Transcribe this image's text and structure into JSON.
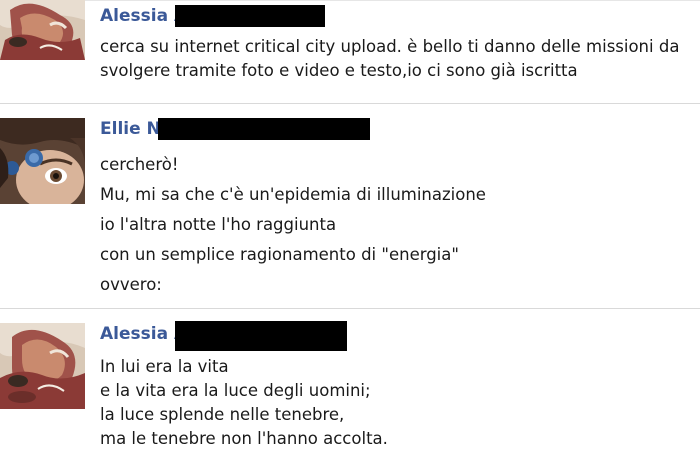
{
  "comments": [
    {
      "author": "Alessia A",
      "lines": [
        "cerca su internet critical city upload. è bello ti danno delle missioni da",
        "svolgere tramite foto e video e testo,io ci sono già iscritta"
      ]
    },
    {
      "author": "Ellie N",
      "lines": [
        "cercherò!",
        "Mu, mi sa che c'è un'epidemia di illuminazione",
        "io l'altra notte l'ho raggiunta",
        "con un semplice ragionamento di \"energia\"",
        "ovvero:"
      ]
    },
    {
      "author": "Alessia A",
      "lines": [
        "In lui era la vita",
        "e la vita era la luce degli uomini;",
        "la luce splende nelle tenebre,",
        "ma le tenebre non l'hanno accolta."
      ]
    }
  ],
  "colors": {
    "author_name": "#3b5998",
    "message_text": "#1a1a1a",
    "divider": "#d9d9d9",
    "redaction": "#000000"
  },
  "icons": {
    "avatar_alessia": "profile-photo-alessia",
    "avatar_ellie": "profile-photo-ellie"
  }
}
